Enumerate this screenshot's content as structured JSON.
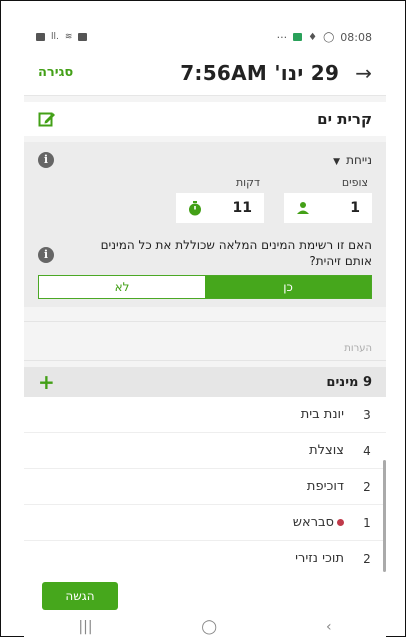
{
  "status_bar": {
    "left_icons": [
      "battery-icon",
      "signal-icon",
      "wifi-icon",
      "gallery-icon"
    ],
    "dots": "···",
    "time": "08:08"
  },
  "header": {
    "close_label": "סגירה",
    "title": "29 ינו' 7:56AM"
  },
  "location": {
    "name": "קרית ים"
  },
  "observation": {
    "method": "נייחת",
    "count_labels": {
      "observers": "צופים",
      "minutes": "דקות"
    },
    "observers_value": "1",
    "minutes_value": "11",
    "question": "האם זו רשימת המינים המלאה שכוללת את כל המינים אותם זיהית?",
    "yes_label": "כן",
    "no_label": "לא"
  },
  "notes": {
    "placeholder": "הערות"
  },
  "species": {
    "title": "9 מינים",
    "rows": [
      {
        "count": "3",
        "name": "יונת בית"
      },
      {
        "count": "4",
        "name": "צוצלת"
      },
      {
        "count": "2",
        "name": "דוכיפת"
      },
      {
        "count": "1",
        "name": "סבראש"
      },
      {
        "count": "2",
        "name": "תוכי נזירי"
      }
    ]
  },
  "footer": {
    "submit_label": "הגשה"
  },
  "colors": {
    "accent": "#46a71c",
    "dot": "#c03a4a"
  }
}
